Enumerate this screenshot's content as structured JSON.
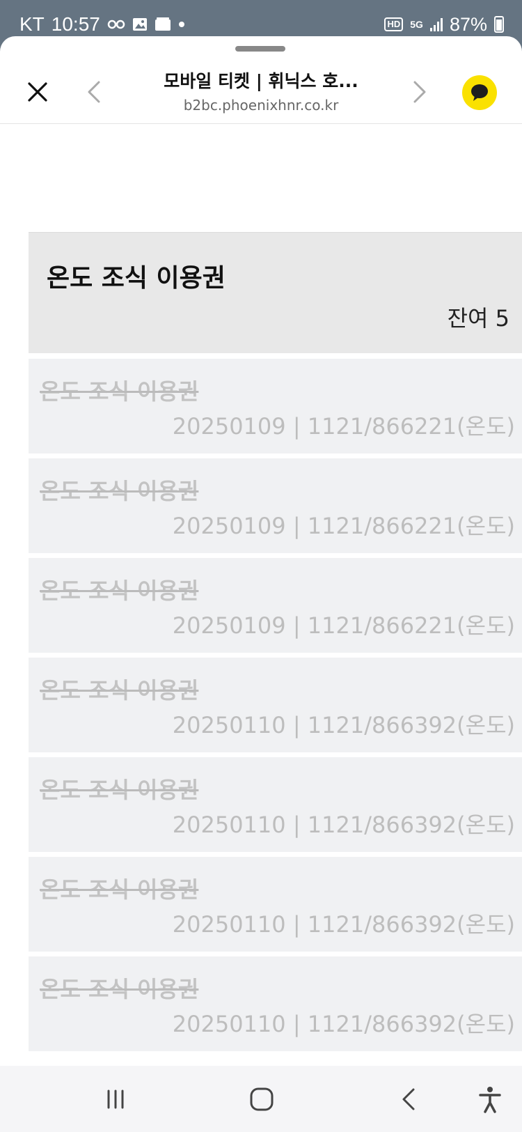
{
  "status_bar": {
    "carrier": "KT",
    "time": "10:57",
    "hd_badge": "HD",
    "network": "5G",
    "battery": "87%"
  },
  "header": {
    "title": "모바일 티켓 | 휘닉스 호...",
    "url": "b2bc.phoenixhnr.co.kr",
    "kakao_color": "#fae100"
  },
  "ticket": {
    "name": "온도 조식 이용권",
    "remaining": "잔여 5"
  },
  "items": [
    {
      "name": "온도 조식 이용권",
      "detail": "20250109 | 1121/866221(온도)"
    },
    {
      "name": "온도 조식 이용권",
      "detail": "20250109 | 1121/866221(온도)"
    },
    {
      "name": "온도 조식 이용권",
      "detail": "20250109 | 1121/866221(온도)"
    },
    {
      "name": "온도 조식 이용권",
      "detail": "20250110 | 1121/866392(온도)"
    },
    {
      "name": "온도 조식 이용권",
      "detail": "20250110 | 1121/866392(온도)"
    },
    {
      "name": "온도 조식 이용권",
      "detail": "20250110 | 1121/866392(온도)"
    },
    {
      "name": "온도 조식 이용권",
      "detail": "20250110 | 1121/866392(온도)"
    }
  ],
  "icons": {
    "close": "close-icon",
    "back": "chevron-left-icon",
    "forward": "chevron-right-icon",
    "kakao": "kakao-chat-icon",
    "nav_recent": "recent-apps-icon",
    "nav_home": "home-icon",
    "nav_back": "back-icon",
    "nav_accessibility": "accessibility-icon"
  }
}
